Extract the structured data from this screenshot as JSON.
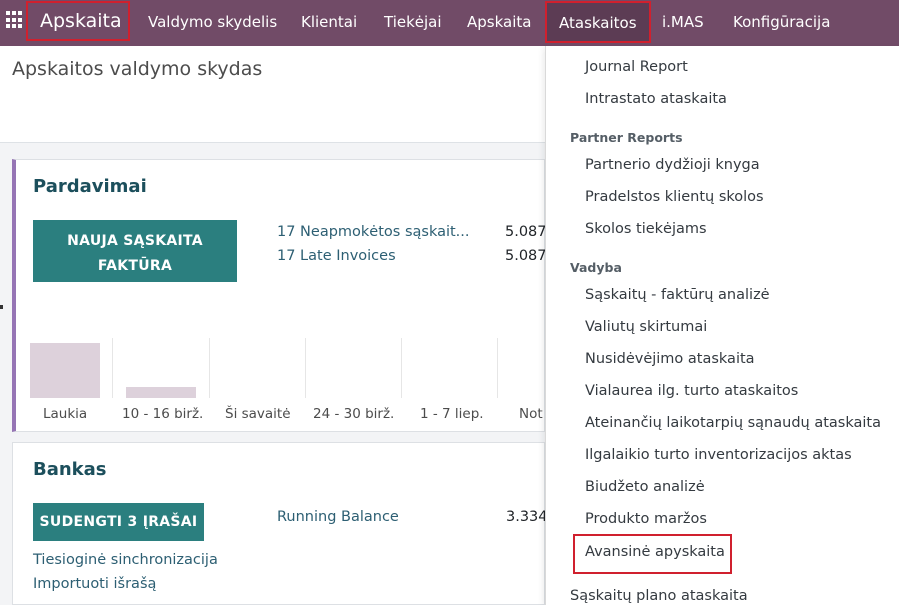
{
  "navbar": {
    "brand": "Apskaita",
    "items": [
      "Valdymo skydelis",
      "Klientai",
      "Tiekėjai",
      "Apskaita",
      "Ataskaitos",
      "i.MAS",
      "Konfigūracija"
    ]
  },
  "page": {
    "title": "Apskaitos valdymo skydas"
  },
  "sales": {
    "title": "Pardavimai",
    "button": [
      "NAUJA SĄSKAITA",
      "FAKTŪRA"
    ],
    "links": [
      "17 Neapmokėtos sąskait...",
      "17 Late Invoices"
    ],
    "amounts": [
      "5.087",
      "5.087"
    ],
    "chart_labels": [
      "Laukia",
      "10 - 16 birž.",
      "Ši savaitė",
      "24 - 30 birž.",
      "1 - 7 liep.",
      "Not"
    ]
  },
  "bank": {
    "title": "Bankas",
    "button": "SUDENGTI 3 ĮRAŠAI",
    "links": [
      "Tiesioginė sinchronizacija",
      "Importuoti išrašą"
    ],
    "balance_label": "Running Balance",
    "balance_amount": "3.334"
  },
  "dropdown": {
    "top_items": [
      "Journal Report",
      "Intrastato ataskaita"
    ],
    "partner_header": "Partner Reports",
    "partner_items": [
      "Partnerio dydžioji knyga",
      "Pradelstos klientų skolos",
      "Skolos tiekėjams"
    ],
    "management_header": "Vadyba",
    "management_items": [
      "Sąskaitų - faktūrų analizė",
      "Valiutų skirtumai",
      "Nusidėvėjimo ataskaita",
      "Vialaurea ilg. turto ataskaitos",
      "Ateinančių laikotarpių sąnaudų ataskaita",
      "Ilgalaikio turto inventorizacijos aktas",
      "Biudžeto analizė",
      "Produkto maržos"
    ],
    "highlighted_item": "Avansinė apyskaita",
    "bottom_item": "Sąskaitų plano ataskaita"
  },
  "colors": {
    "navbar": "#714b67",
    "highlight": "#d0202e",
    "primary_button": "#2b7f7f",
    "title": "#1c4f5c"
  }
}
